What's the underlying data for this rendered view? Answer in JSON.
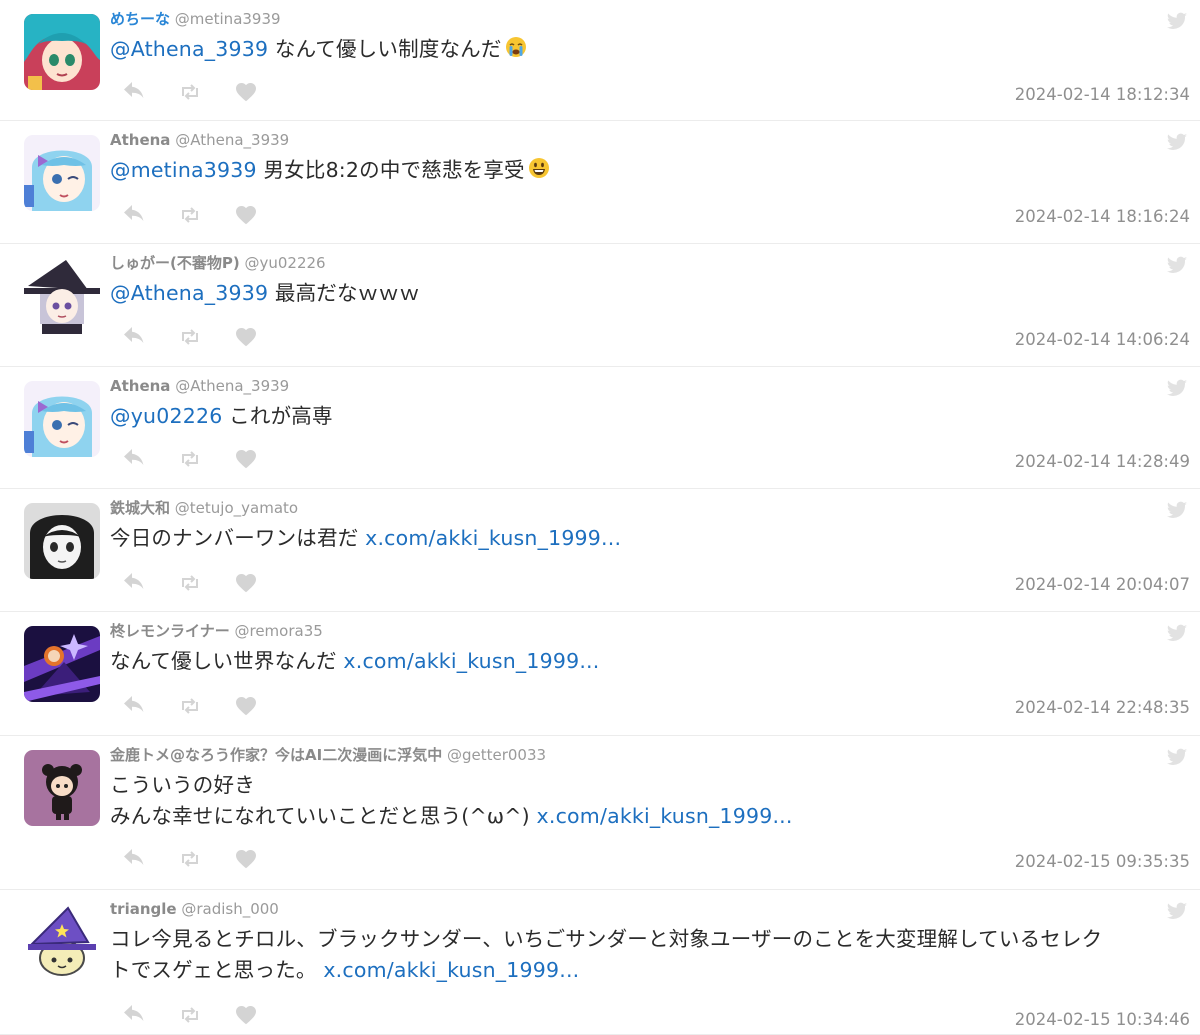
{
  "tweets": [
    {
      "name": "めちーな",
      "name_color": "#2a86d6",
      "handle": "@metina3939",
      "lines": [
        [
          {
            "t": "mention",
            "v": "@Athena_3939"
          },
          {
            "t": "text",
            "v": " なんて優しい制度なんだ"
          },
          {
            "t": "emoji",
            "v": "crying-face"
          }
        ]
      ],
      "time": "2024-02-14 18:12:34",
      "avatar": "teal-hair-girl"
    },
    {
      "name": "Athena",
      "name_color": "#8a8a8a",
      "handle": "@Athena_3939",
      "lines": [
        [
          {
            "t": "mention",
            "v": "@metina3939"
          },
          {
            "t": "text",
            "v": " 男女比8:2の中で慈悲を享受"
          },
          {
            "t": "emoji",
            "v": "smile-face"
          }
        ]
      ],
      "time": "2024-02-14 18:16:24",
      "avatar": "blue-hair-wink"
    },
    {
      "name": "しゅがー(不審物P)",
      "name_color": "#8a8a8a",
      "handle": "@yu02226",
      "lines": [
        [
          {
            "t": "mention",
            "v": "@Athena_3939"
          },
          {
            "t": "text",
            "v": " 最高だなｗｗｗ"
          }
        ]
      ],
      "time": "2024-02-14 14:06:24",
      "avatar": "witch-girl"
    },
    {
      "name": "Athena",
      "name_color": "#8a8a8a",
      "handle": "@Athena_3939",
      "lines": [
        [
          {
            "t": "mention",
            "v": "@yu02226"
          },
          {
            "t": "text",
            "v": " これが高専"
          }
        ]
      ],
      "time": "2024-02-14 14:28:49",
      "avatar": "blue-hair-wink"
    },
    {
      "name": "鉄城大和",
      "name_color": "#8a8a8a",
      "handle": "@tetujo_yamato",
      "lines": [
        [
          {
            "t": "text",
            "v": "今日のナンバーワンは君だ "
          },
          {
            "t": "link",
            "v": "x.com/akki_kusn_1999..."
          }
        ]
      ],
      "time": "2024-02-14 20:04:07",
      "avatar": "monochrome-girl"
    },
    {
      "name": "柊レモンライナー",
      "name_color": "#8a8a8a",
      "handle": "@remora35",
      "lines": [
        [
          {
            "t": "text",
            "v": "なんて優しい世界なんだ "
          },
          {
            "t": "link",
            "v": "x.com/akki_kusn_1999..."
          }
        ]
      ],
      "time": "2024-02-14 22:48:35",
      "avatar": "purple-magic-art"
    },
    {
      "name": "金鹿トメ@なろう作家？今はAI二次漫画に浮気中",
      "name_color": "#8a8a8a",
      "handle": "@getter0033",
      "lines": [
        [
          {
            "t": "text",
            "v": "こういうの好き"
          }
        ],
        [
          {
            "t": "text",
            "v": "みんな幸せになれていいことだと思う(^ω^) "
          },
          {
            "t": "link",
            "v": "x.com/akki_kusn_1999..."
          }
        ]
      ],
      "time": "2024-02-15 09:35:35",
      "avatar": "chibi-on-purple"
    },
    {
      "name": "triangle",
      "name_color": "#8a8a8a",
      "handle": "@radish_000",
      "lines": [
        [
          {
            "t": "text",
            "v": "コレ今見るとチロル、ブラックサンダー、いちごサンダーと対象ユーザーのことを大変理解しているセレク"
          }
        ],
        [
          {
            "t": "text",
            "v": "トでスゲェと思った。 "
          },
          {
            "t": "link",
            "v": "x.com/akki_kusn_1999..."
          }
        ]
      ],
      "time": "2024-02-15 10:34:46",
      "avatar": "radish-wizard-hat"
    }
  ],
  "colors": {
    "mention": "#1d6fbf",
    "icon": "#d4d4d4",
    "time": "#8f8f8f"
  }
}
